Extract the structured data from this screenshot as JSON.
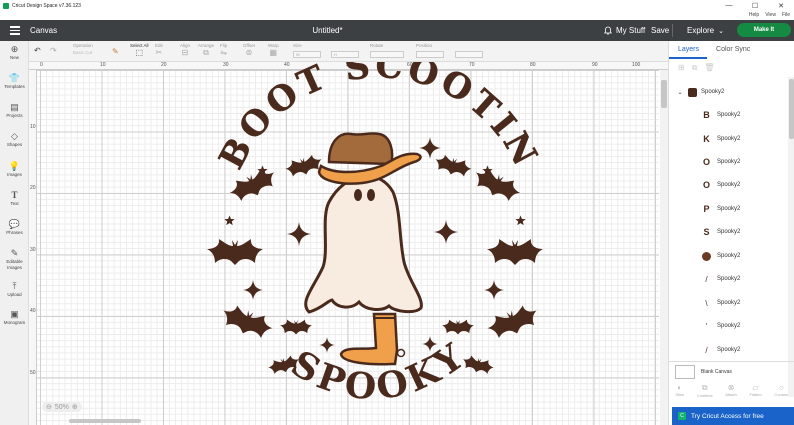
{
  "window": {
    "title": "Cricut Design Space  v7.36.123"
  },
  "menubar": {
    "items": [
      "Help",
      "View",
      "File"
    ]
  },
  "header": {
    "canvas_label": "Canvas",
    "doc_title": "Untitled*",
    "my_stuff": "My Stuff",
    "save": "Save",
    "explore": "Explore",
    "make_it": "Make It"
  },
  "toolbar": {
    "operation": "Operation",
    "operation_value": "Basic Cut",
    "select_all": "Select All",
    "edit": "Edit",
    "align": "Align",
    "arrange": "Arrange",
    "flip": "Flip",
    "offset": "Offset",
    "warp": "Warp",
    "size": "Size",
    "rotate": "Rotate",
    "position": "Position",
    "size_w": "W",
    "size_h": "H"
  },
  "leftbar": {
    "items": [
      {
        "label": "New",
        "icon": "plus-circle-icon"
      },
      {
        "label": "Templates",
        "icon": "shirt-icon"
      },
      {
        "label": "Projects",
        "icon": "projects-icon"
      },
      {
        "label": "Shapes",
        "icon": "shapes-icon"
      },
      {
        "label": "Images",
        "icon": "lightbulb-icon"
      },
      {
        "label": "Text",
        "icon": "text-icon"
      },
      {
        "label": "Phrases",
        "icon": "phrases-icon"
      },
      {
        "label": "Editable Images",
        "icon": "editable-images-icon"
      },
      {
        "label": "Upload",
        "icon": "upload-icon"
      },
      {
        "label": "Monogram",
        "icon": "monogram-icon"
      }
    ]
  },
  "ruler": {
    "top": [
      "0",
      "10",
      "20",
      "30",
      "40",
      "50",
      "60",
      "70",
      "80",
      "90",
      "100"
    ],
    "left": [
      "10",
      "20",
      "30",
      "40",
      "50"
    ]
  },
  "zoom": {
    "value": "50%"
  },
  "artwork": {
    "top_text": "BOOT SCOOTIN",
    "bottom_text": "SPOOKY"
  },
  "rightpanel": {
    "tabs": [
      "Layers",
      "Color Sync"
    ],
    "group": {
      "name": "Spooky2"
    },
    "layers": [
      {
        "name": "Spooky2",
        "thumb": "B"
      },
      {
        "name": "Spooky2",
        "thumb": "K"
      },
      {
        "name": "Spooky2",
        "thumb": "O"
      },
      {
        "name": "Spooky2",
        "thumb": "O"
      },
      {
        "name": "Spooky2",
        "thumb": "P"
      },
      {
        "name": "Spooky2",
        "thumb": "S"
      },
      {
        "name": "Spooky2",
        "thumb": "•"
      },
      {
        "name": "Spooky2",
        "thumb": "/"
      },
      {
        "name": "Spooky2",
        "thumb": "\\"
      },
      {
        "name": "Spooky2",
        "thumb": "'"
      },
      {
        "name": "Spooky2",
        "thumb": "/"
      }
    ],
    "blank_canvas": "Blank Canvas",
    "bottom_actions": [
      "Slice",
      "Combine",
      "Attach",
      "Flatten",
      "Contour"
    ],
    "cta": "Try Cricut Access for free"
  },
  "colors": {
    "header": "#3d4043",
    "accent": "#1a63c9",
    "make_it": "#148a43",
    "ink": "#4a2a1c",
    "hat": "#a36a3c",
    "brim": "#f0a04b",
    "ghost": "#f8ece0"
  }
}
